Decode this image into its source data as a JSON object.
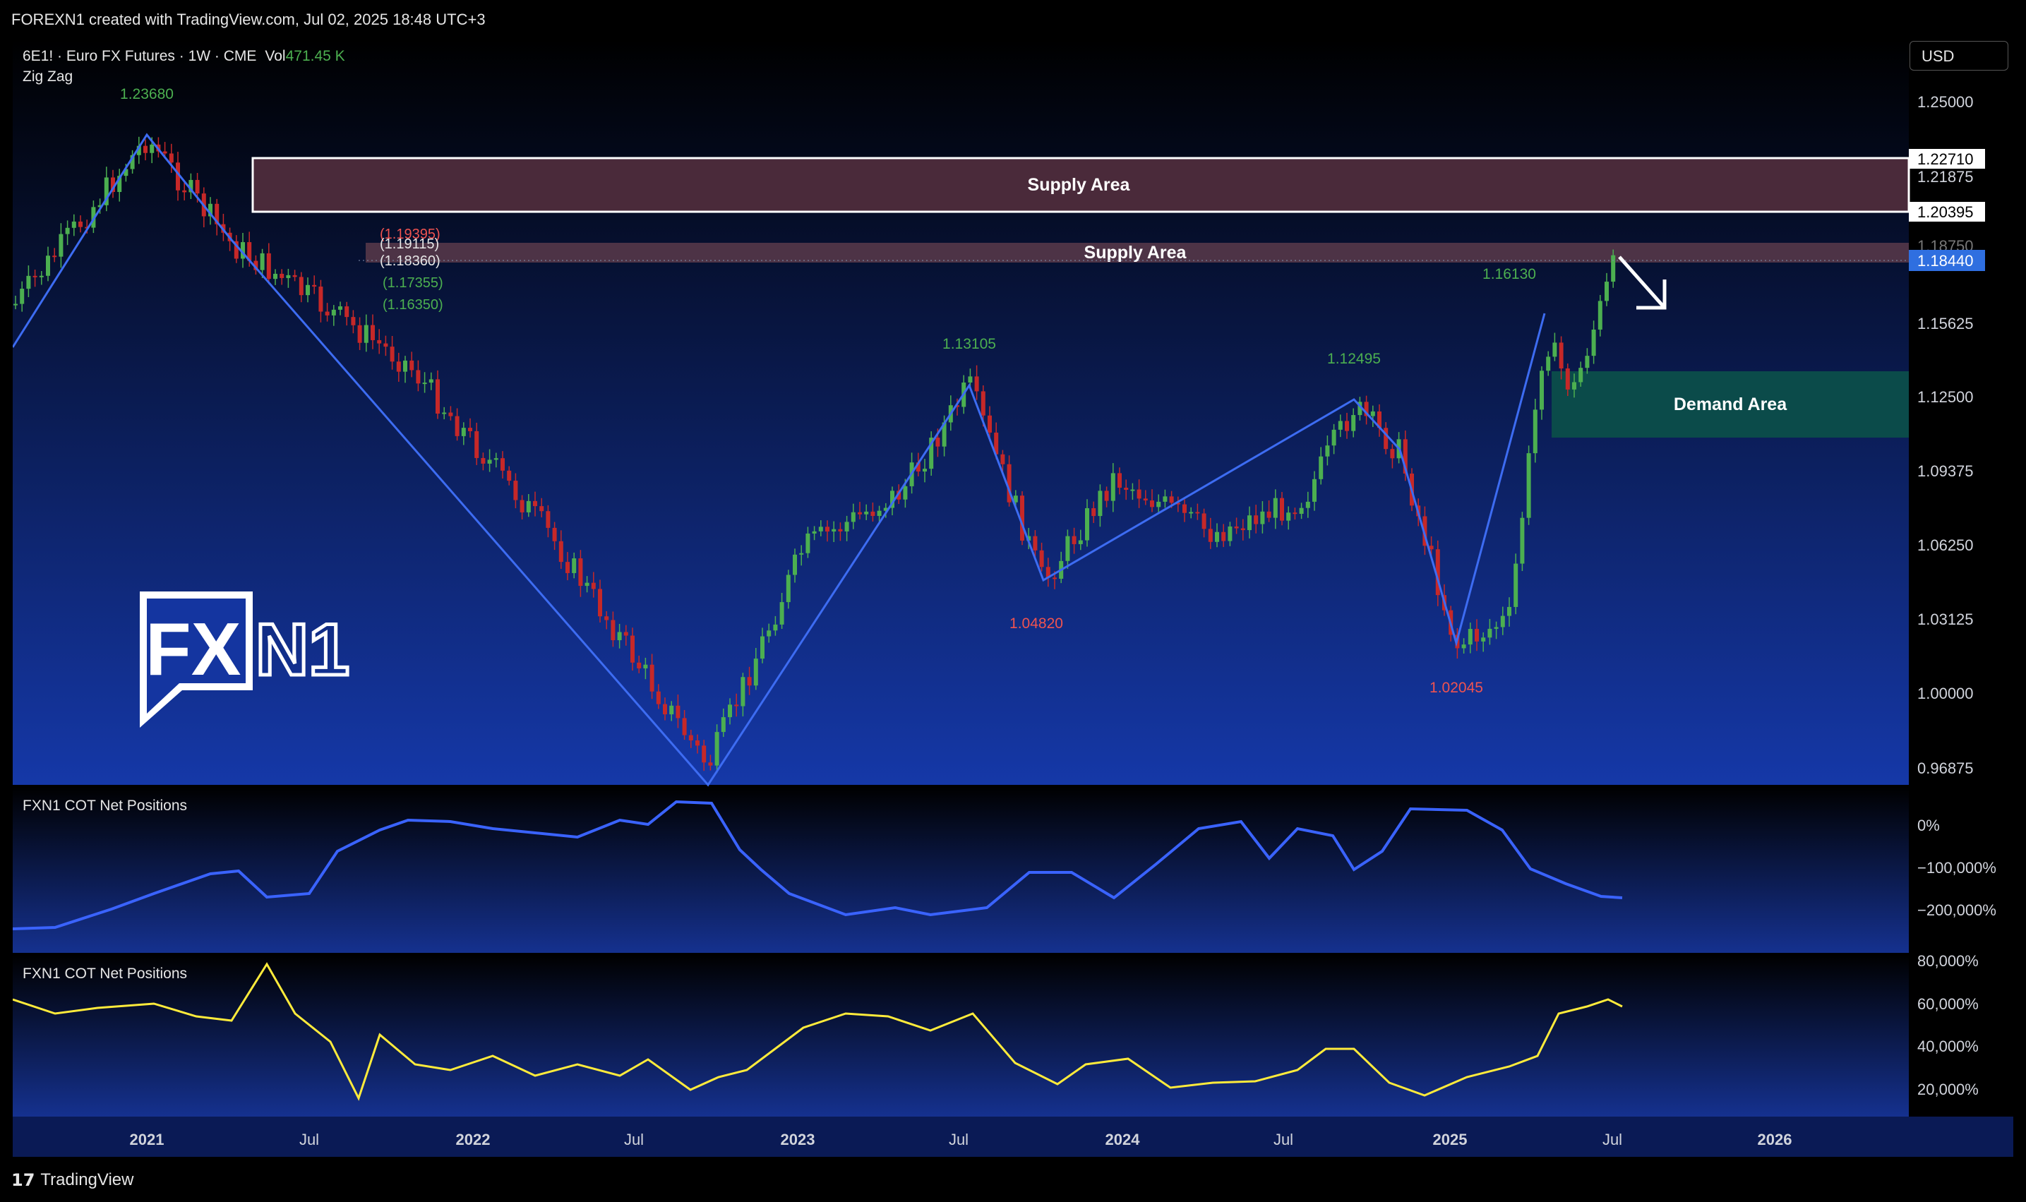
{
  "header": {
    "attribution": "FOREXN1 created with TradingView.com, Jul 02, 2025 18:48 UTC+3"
  },
  "legend": {
    "symbol": "6E1! · Euro FX Futures · 1W · CME",
    "vol_label": "Vol",
    "vol_value": "471.45 K",
    "indicator": "Zig Zag"
  },
  "currency_button": "USD",
  "price_axis": {
    "ticks": [
      "1.25000",
      "1.21875",
      "1.15625",
      "1.12500",
      "1.09375",
      "1.06250",
      "1.03125",
      "1.00000",
      "0.96875"
    ],
    "line_labels": [
      "1.22710",
      "1.20395"
    ],
    "current_price": "1.18440",
    "hidden_price": "1.18750"
  },
  "zones": {
    "supply_upper": "Supply Area",
    "supply_lower": "Supply Area",
    "demand": "Demand Area"
  },
  "zigzag_labels": {
    "high_2021": "1.23680",
    "low_2022": "",
    "high_2023": "1.13105",
    "low_2023": "1.04820",
    "high_2024": "1.12495",
    "low_2025": "1.02045",
    "high_2025": "1.16130"
  },
  "position_labels": [
    "(1.19395)",
    "(1.19115)",
    "(1.18360)",
    "(1.17355)",
    "(1.16350)"
  ],
  "panes": {
    "cot1_title": "FXN1 COT Net Positions",
    "cot1_ticks": [
      "0%",
      "−100,000%",
      "−200,000%"
    ],
    "cot2_title": "FXN1 COT Net Positions",
    "cot2_ticks": [
      "80,000%",
      "60,000%",
      "40,000%",
      "20,000%"
    ]
  },
  "time_axis": [
    "2021",
    "Jul",
    "2022",
    "Jul",
    "2023",
    "Jul",
    "2024",
    "Jul",
    "2025",
    "Jul",
    "2026"
  ],
  "logo_text": {
    "fx": "FX",
    "n1": "N1"
  },
  "footer": {
    "brand": "TradingView",
    "mark": "17"
  },
  "colors": {
    "up": "#4caf50",
    "down": "#c62828",
    "zigzag": "#3d6cf2",
    "cot_blue": "#3a63ff",
    "cot_yellow": "#ffeb3b",
    "supply": "#4a2a3a",
    "demand": "#0b4b4a",
    "label_green": "#4caf50",
    "label_red": "#ef5350"
  }
}
